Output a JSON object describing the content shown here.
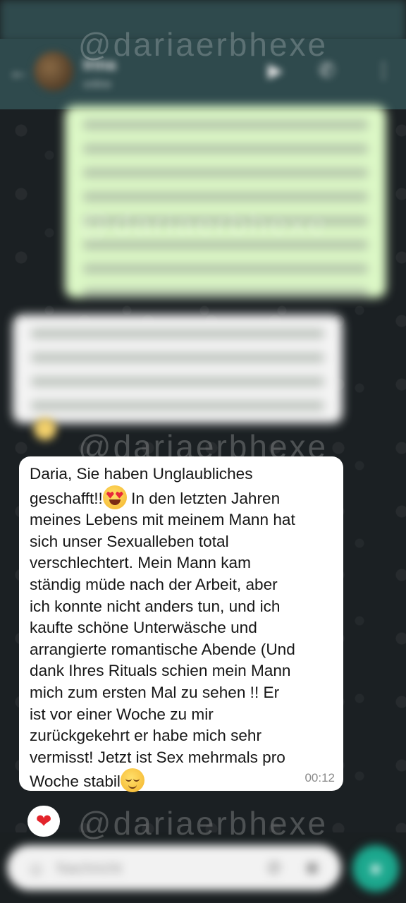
{
  "watermark": "@dariaerbhexe",
  "header": {
    "contact_name": "Irina",
    "contact_status": "online"
  },
  "message": {
    "part1": "Daria, Sie haben Unglaubliches\ngeschafft!!",
    "part2": " In den letzten Jahren\nmeines Lebens mit meinem Mann hat\nsich unser Sexualleben total\nverschlechtert. Mein Mann kam\nständig müde nach der Arbeit, aber\nich konnte nicht anders tun, und ich\nkaufte schöne Unterwäsche und\narrangierte romantische Abende (Und\ndank Ihres Rituals schien mein Mann\nmich zum ersten Mal zu sehen !! Er\nist vor einer Woche zu mir\nzurückgekehrt er habe mich sehr\nvermisst! Jetzt ist Sex mehrmals pro\nWoche stabil",
    "emoji1": "smiling-face-with-heart-eyes",
    "emoji2": "relieved-face",
    "time": "00:12",
    "reaction": "❤"
  },
  "composer": {
    "placeholder": "Nachricht"
  },
  "colors": {
    "header_bg": "#2f4a4d",
    "chat_bg": "#1b2023",
    "incoming_bubble": "#ffffff",
    "outgoing_bubble": "#dcf8c6",
    "accent": "#1ca88e",
    "heart": "#e3242b"
  }
}
